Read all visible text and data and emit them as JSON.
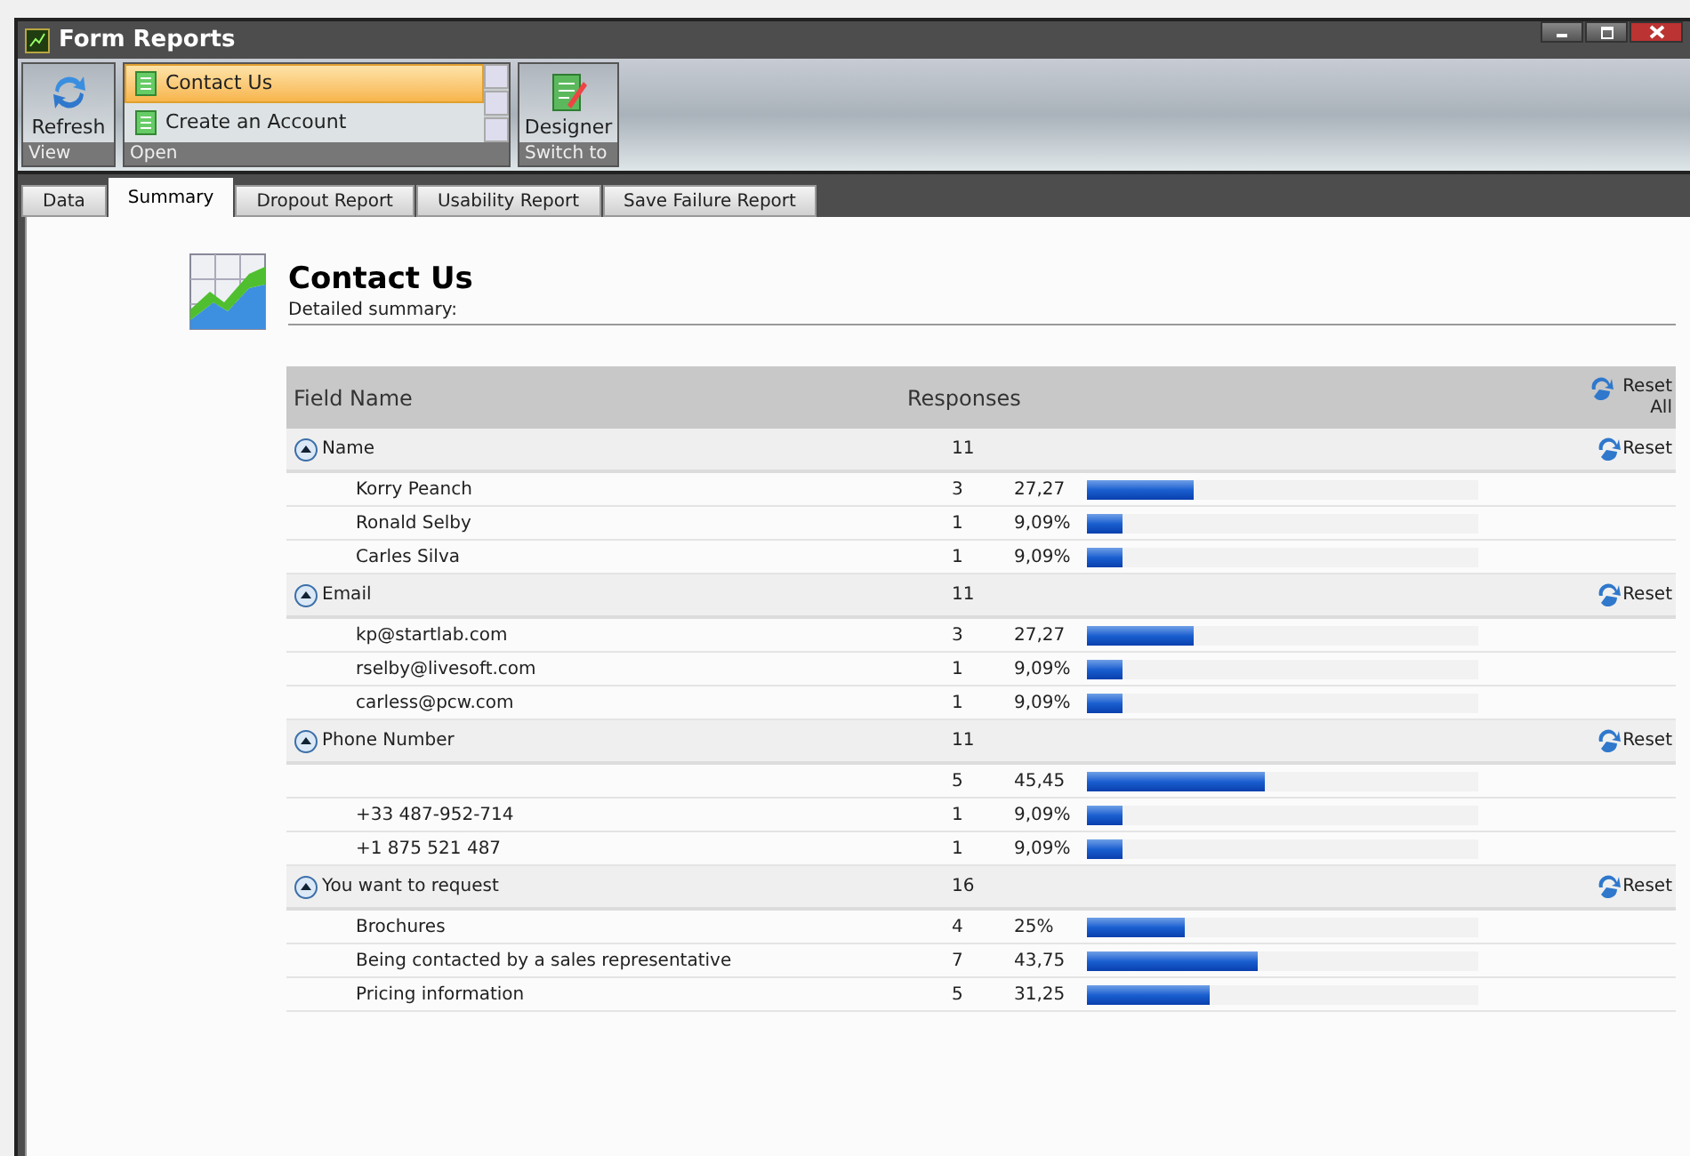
{
  "window": {
    "title": "Form Reports"
  },
  "ribbon": {
    "refresh": {
      "label": "Refresh",
      "group": "View"
    },
    "forms": [
      {
        "label": "Contact Us",
        "selected": true
      },
      {
        "label": "Create an Account",
        "selected": false
      }
    ],
    "open_group": "Open",
    "designer": {
      "label": "Designer",
      "group": "Switch to"
    }
  },
  "tabs": [
    {
      "label": "Data",
      "selected": false
    },
    {
      "label": "Summary",
      "selected": true
    },
    {
      "label": "Dropout Report",
      "selected": false
    },
    {
      "label": "Usability Report",
      "selected": false
    },
    {
      "label": "Save Failure Report",
      "selected": false
    }
  ],
  "report": {
    "title": "Contact Us",
    "subtitle": "Detailed summary:"
  },
  "table": {
    "columns": [
      "Field Name",
      "Responses"
    ],
    "reset_all": "Reset All",
    "groups": [
      {
        "name": "Name",
        "count": "11",
        "reset": "Reset",
        "expanded": true,
        "rows": [
          {
            "value": "Korry Peanch",
            "count": "3",
            "percent": "27,27",
            "level": 0.2727
          },
          {
            "value": "Ronald Selby",
            "count": "1",
            "percent": "9,09%",
            "level": 0.0909
          },
          {
            "value": "Carles Silva",
            "count": "1",
            "percent": "9,09%",
            "level": 0.0909
          }
        ]
      },
      {
        "name": "Email",
        "count": "11",
        "reset": "Reset",
        "expanded": true,
        "rows": [
          {
            "value": "kp@startlab.com",
            "count": "3",
            "percent": "27,27",
            "level": 0.2727
          },
          {
            "value": "rselby@livesoft.com",
            "count": "1",
            "percent": "9,09%",
            "level": 0.0909
          },
          {
            "value": "carless@pcw.com",
            "count": "1",
            "percent": "9,09%",
            "level": 0.0909
          }
        ]
      },
      {
        "name": "Phone Number",
        "count": "11",
        "reset": "Reset",
        "expanded": true,
        "rows": [
          {
            "count": "5",
            "percent": "45,45",
            "level": 0.4545
          },
          {
            "value": "+33 487-952-714",
            "count": "1",
            "percent": "9,09%",
            "level": 0.0909
          },
          {
            "value": "+1 875 521 487",
            "count": "1",
            "percent": "9,09%",
            "level": 0.0909
          }
        ]
      },
      {
        "name": "You want to request",
        "count": "16",
        "reset": "Reset",
        "expanded": true,
        "rows": [
          {
            "value": "Brochures",
            "count": "4",
            "percent": "25%",
            "level": 0.25
          },
          {
            "value": "Being contacted by a sales representative",
            "count": "7",
            "percent": "43,75",
            "level": 0.4375
          },
          {
            "value": "Pricing information",
            "count": "5",
            "percent": "31,25",
            "level": 0.3125
          }
        ]
      }
    ]
  }
}
